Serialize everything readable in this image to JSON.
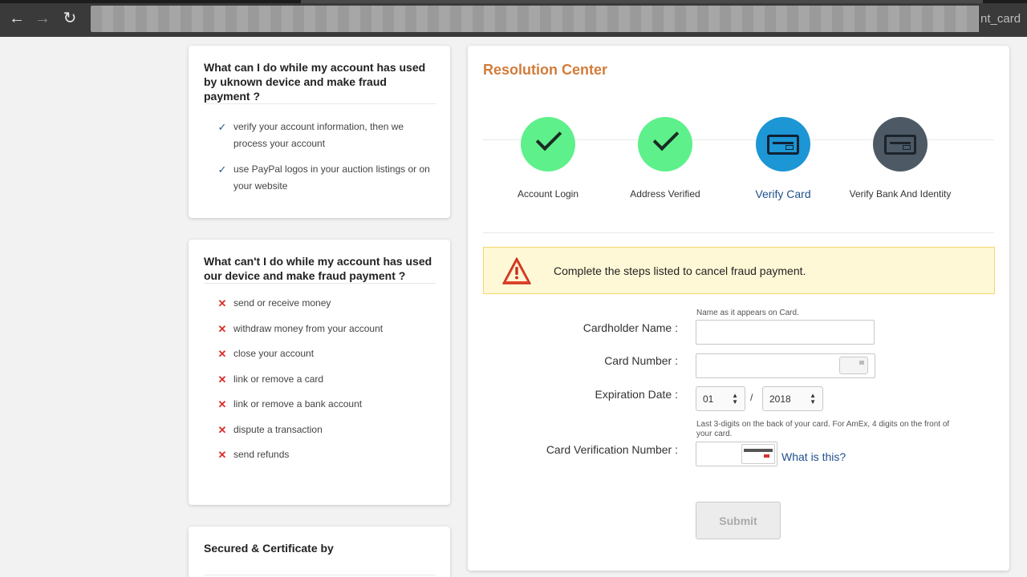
{
  "browser": {
    "url_tail": "nt_card"
  },
  "sidebar": {
    "can_card": {
      "title": "What can I do while my account has used by uknown device and make fraud payment ?",
      "items": [
        "verify your account information, then we process your account",
        "use PayPal logos in your auction listings or on your website"
      ]
    },
    "cant_card": {
      "title": "What can't I do while my account has used our device and make fraud payment ?",
      "items": [
        "send or receive money",
        "withdraw money from your account",
        "close your account",
        "link or remove a card",
        "link or remove a bank account",
        "dispute a transaction",
        "send refunds"
      ]
    },
    "secured_card": {
      "title": "Secured & Certificate by"
    }
  },
  "main": {
    "title": "Resolution Center",
    "steps": [
      {
        "label": "Account Login",
        "status": "done",
        "icon": "check-icon"
      },
      {
        "label": "Address Verified",
        "status": "done",
        "icon": "check-icon"
      },
      {
        "label": "Verify Card",
        "status": "current",
        "icon": "credit-card-icon"
      },
      {
        "label": "Verify Bank And Identity",
        "status": "pending",
        "icon": "bank-card-icon"
      }
    ],
    "alert": {
      "message": "Complete the steps listed to cancel fraud payment.",
      "icon": "warning-icon"
    },
    "form": {
      "cardholder_hint": "Name as it appears on Card.",
      "cardholder_label": "Cardholder Name :",
      "cardholder_value": "",
      "card_number_label": "Card Number :",
      "card_number_value": "",
      "expiration_label": "Expiration Date :",
      "exp_month": "01",
      "exp_year": "2018",
      "exp_separator": "/",
      "cvv_hint": "Last 3-digits on the back of your card. For AmEx, 4 digits on the front of your card.",
      "cvv_label": "Card Verification Number :",
      "cvv_value": "",
      "cvv_link": "What is this?",
      "submit_label": "Submit"
    }
  },
  "colors": {
    "title_orange": "#d27c3a",
    "step_done": "#5ef08a",
    "step_current": "#1c96d4",
    "step_pending": "#4d5a66",
    "link_blue": "#1f4f8c",
    "alert_bg": "#fff8d6",
    "error_red": "#d9302c"
  }
}
